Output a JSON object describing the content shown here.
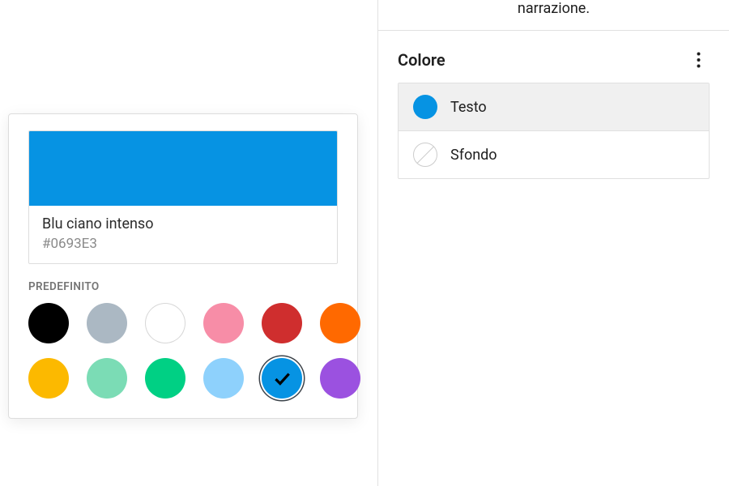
{
  "sidebar": {
    "snippet_tail": "narrazione.",
    "panel_title": "Colore",
    "rows": {
      "text": {
        "label": "Testo",
        "color": "#0693E3"
      },
      "background": {
        "label": "Sfondo"
      }
    }
  },
  "picker": {
    "current": {
      "name": "Blu ciano intenso",
      "hex": "#0693E3",
      "color": "#0693E3"
    },
    "preset_label": "PREDEFINITO",
    "swatches": [
      {
        "name": "black",
        "hex": "#000000"
      },
      {
        "name": "gray",
        "hex": "#ABB8C3"
      },
      {
        "name": "white",
        "hex": "#FFFFFF",
        "bordered": true
      },
      {
        "name": "pink",
        "hex": "#F78DA7"
      },
      {
        "name": "red",
        "hex": "#CF2E2E"
      },
      {
        "name": "orange",
        "hex": "#FF6900"
      },
      {
        "name": "amber",
        "hex": "#FCB900"
      },
      {
        "name": "mint",
        "hex": "#7BDCB5"
      },
      {
        "name": "green",
        "hex": "#00D084"
      },
      {
        "name": "sky",
        "hex": "#8ED1FC"
      },
      {
        "name": "cyan-blue",
        "hex": "#0693E3",
        "selected": true
      },
      {
        "name": "purple",
        "hex": "#9B51E0"
      }
    ]
  }
}
